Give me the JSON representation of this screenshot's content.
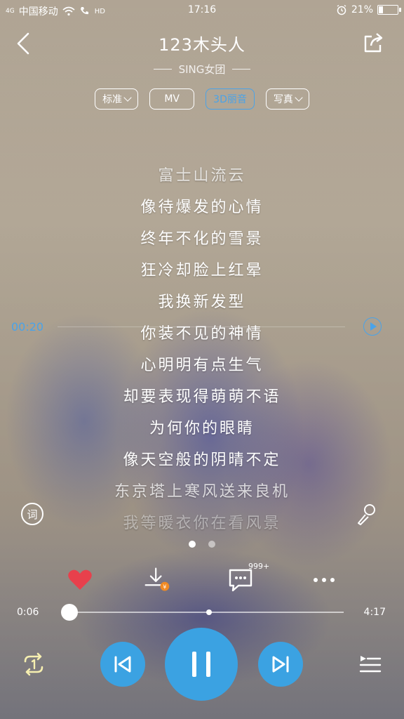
{
  "status_bar": {
    "carrier": "中国移动",
    "network": "4G",
    "hd": "HD",
    "time": "17:16",
    "battery_text": "21%",
    "battery_level": 0.21
  },
  "header": {
    "song_title": "123木头人",
    "artist": "SING女团"
  },
  "options": [
    {
      "label": "标准",
      "has_dropdown": true,
      "active": false
    },
    {
      "label": "MV",
      "has_dropdown": false,
      "active": false
    },
    {
      "label": "3D丽音",
      "has_dropdown": false,
      "active": true
    },
    {
      "label": "写真",
      "has_dropdown": true,
      "active": false
    }
  ],
  "lyrics": [
    "富士山流云",
    "像待爆发的心情",
    "终年不化的雪景",
    "狂冷却脸上红晕",
    "我换新发型",
    "你装不见的神情",
    "心明明有点生气",
    "却要表现得萌萌不语",
    "为何你的眼睛",
    "像天空般的阴晴不定",
    "东京塔上寒风送来良机",
    "我等暖衣你在看风景"
  ],
  "seek_preview": {
    "time": "00:20"
  },
  "lyric_button": "词",
  "actions": {
    "comment_count": "999+"
  },
  "progress": {
    "current": "0:06",
    "total": "4:17",
    "played_fraction": 0.023,
    "buffered_fraction": 0.52
  },
  "colors": {
    "accent": "#3ba2e2",
    "favorite": "#e8404c",
    "vip_badge": "#f08a24"
  },
  "page_indicator": {
    "count": 2,
    "active": 0
  }
}
